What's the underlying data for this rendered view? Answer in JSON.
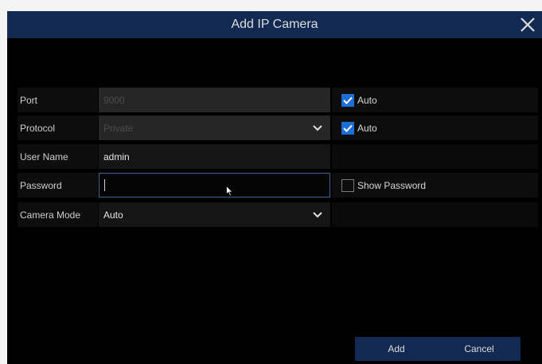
{
  "dialog": {
    "title": "Add IP Camera"
  },
  "form": {
    "port": {
      "label": "Port",
      "value": "9000",
      "auto_label": "Auto",
      "auto_checked": true
    },
    "protocol": {
      "label": "Protocol",
      "value": "Private",
      "auto_label": "Auto",
      "auto_checked": true
    },
    "username": {
      "label": "User Name",
      "value": "admin"
    },
    "password": {
      "label": "Password",
      "value": "",
      "show_label": "Show Password",
      "show_checked": false
    },
    "camera_mode": {
      "label": "Camera Mode",
      "value": "Auto"
    }
  },
  "buttons": {
    "add": "Add",
    "cancel": "Cancel"
  },
  "icons": {
    "close": "close-icon",
    "dropdown": "chevron-down-icon",
    "check": "checkmark-icon",
    "cursor": "mouse-pointer-icon"
  },
  "colors": {
    "titlebar": "#122a51",
    "checkbox_on": "#1d6fd6",
    "focus_border": "#3c6591"
  }
}
